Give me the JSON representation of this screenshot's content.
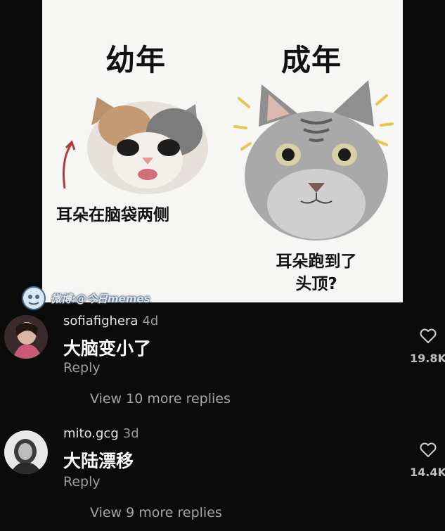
{
  "meme": {
    "title_young": "幼年",
    "title_adult": "成年",
    "caption_young": "耳朵在脑袋两侧",
    "caption_adult_line1": "耳朵跑到了",
    "caption_adult_line2": "头顶?",
    "watermark": "微博:@今日memes"
  },
  "comments": [
    {
      "username": "sofiafighera",
      "age": "4d",
      "text": "大脑变小了",
      "reply_label": "Reply",
      "likes": "19.8K",
      "view_replies": "View 10 more replies"
    },
    {
      "username": "mito.gcg",
      "age": "3d",
      "text": "大陆漂移",
      "reply_label": "Reply",
      "likes": "14.4K",
      "view_replies": "View 9 more replies"
    }
  ],
  "icons": {
    "like": "heart-outline-icon",
    "watermark_logo": "weibo-avatar-logo"
  },
  "colors": {
    "background": "#0b0b0b",
    "meme_background": "#f6f6f4",
    "username": "#e6e6e6",
    "muted": "#9e9e9e"
  }
}
